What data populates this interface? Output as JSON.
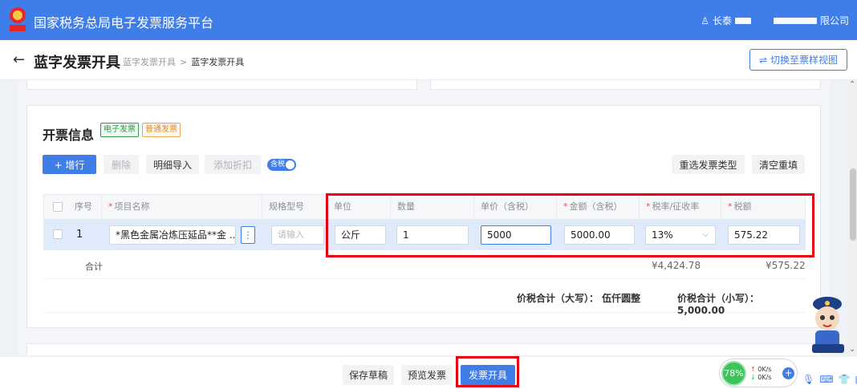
{
  "header": {
    "app_title": "国家税务总局电子发票服务平台",
    "user_prefix": "长泰",
    "company_suffix": "限公司",
    "colors": {
      "primary": "#3f7ee8",
      "highlight": "#e60012"
    }
  },
  "subheader": {
    "page_title": "蓝字发票开具",
    "breadcrumb": [
      "蓝字发票开具",
      "蓝字发票开具"
    ],
    "switch_view_label": "切换至票样视图"
  },
  "invoice_info": {
    "section_title": "开票信息",
    "tags": [
      "电子发票",
      "普通发票"
    ],
    "toolbar": {
      "add_row": "+ 增行",
      "delete": "删除",
      "detail_import": "明细导入",
      "add_discount": "添加折扣",
      "tax_toggle": "含税",
      "reselect_type": "重选发票类型",
      "clear_refill": "清空重填"
    },
    "columns": [
      "序号",
      "项目名称",
      "规格型号",
      "单位",
      "数量",
      "单价（含税）",
      "金额（含税）",
      "税率/征收率",
      "税额"
    ],
    "rows": [
      {
        "index": "1",
        "item_name": "*黑色金属冶炼压延品**金 ...",
        "spec_placeholder": "请输入",
        "unit": "公斤",
        "quantity": "1",
        "unit_price": "5000",
        "amount": "5000.00",
        "tax_rate": "13%",
        "tax_amount": "575.22"
      }
    ],
    "summary": {
      "label": "合计",
      "amount_total": "¥4,424.78",
      "tax_total": "¥575.22"
    },
    "totals": {
      "upper": "价税合计（大写）：  伍仟圆整",
      "lower": "价税合计（小写）：5,000.00"
    }
  },
  "footer": {
    "save_draft": "保存草稿",
    "preview": "预览发票",
    "issue": "发票开具"
  },
  "float_widget": {
    "gauge": "78%",
    "up_speed": "0K/s",
    "down_speed": "0K/s"
  }
}
